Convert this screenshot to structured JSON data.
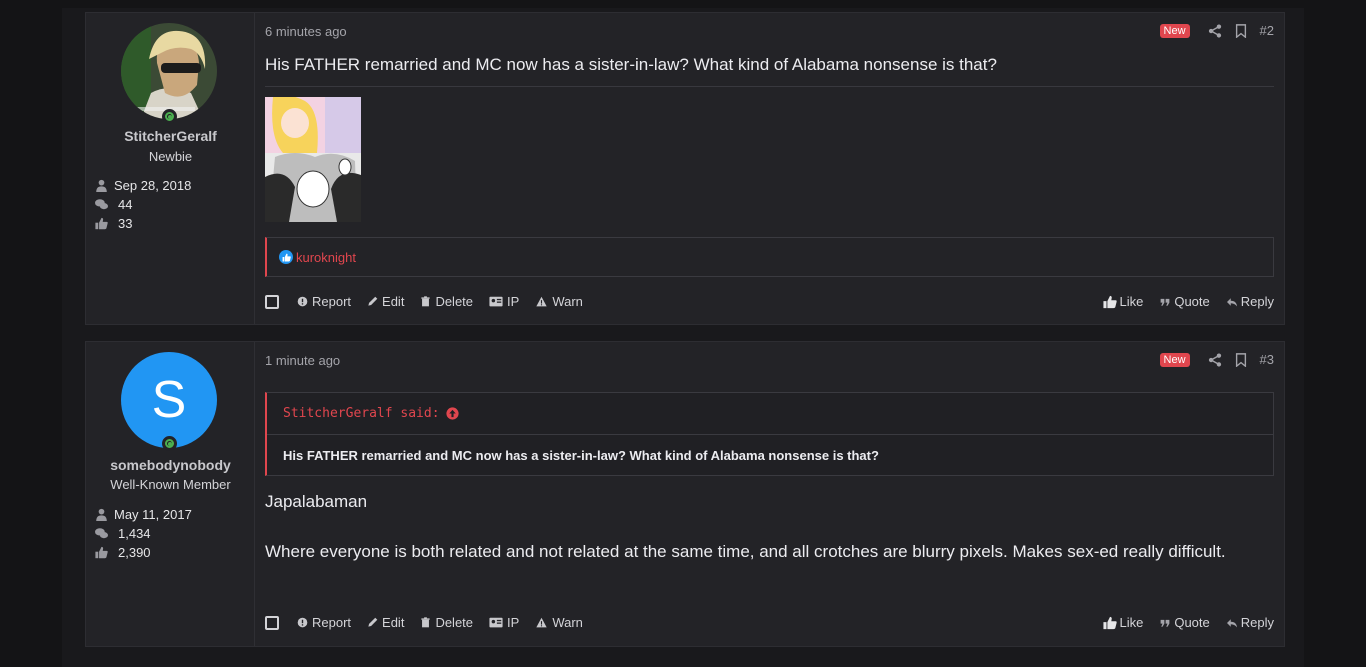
{
  "posts": [
    {
      "author": "StitcherGeralf",
      "user_title": "Newbie",
      "joined": "Sep 28, 2018",
      "messages": "44",
      "reactions": "33",
      "time": "6 minutes ago",
      "badge": "New",
      "post_number": "#2",
      "text": "His FATHER remarried and MC now has a sister-in-law? What kind of Alabama nonsense is that?",
      "reacted_by": "kuroknight"
    },
    {
      "author": "somebodynobody",
      "user_title": "Well-Known Member",
      "avatar_letter": "S",
      "joined": "May 11, 2017",
      "messages": "1,434",
      "reactions": "2,390",
      "time": "1 minute ago",
      "badge": "New",
      "post_number": "#3",
      "quote_author": "StitcherGeralf said:",
      "quote_text": "His FATHER remarried and MC now has a sister-in-law? What kind of Alabama nonsense is that?",
      "text_1": "Japalabaman",
      "text_2": "Where everyone is both related and not related at the same time, and all crotches are blurry pixels. Makes sex-ed really difficult."
    }
  ],
  "actions": {
    "report": "Report",
    "edit": "Edit",
    "delete": "Delete",
    "ip": "IP",
    "warn": "Warn",
    "like": "Like",
    "quote": "Quote",
    "reply": "Reply"
  },
  "colors": {
    "accent": "#e0464e",
    "avatar_blue": "#2196f3",
    "online": "#4caf50",
    "post_bg": "#232327"
  }
}
